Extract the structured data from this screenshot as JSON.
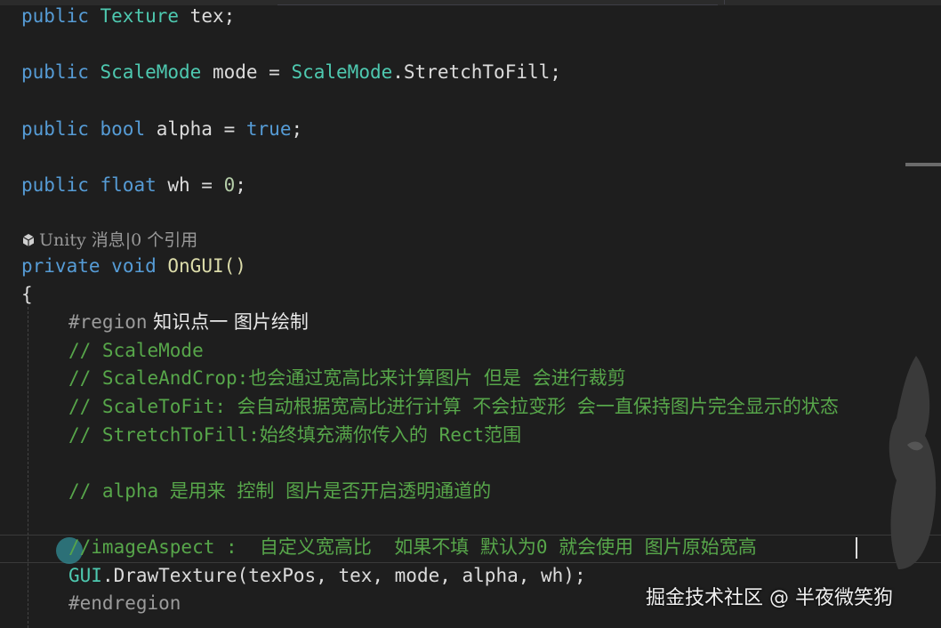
{
  "code": {
    "l1": {
      "kw": "public",
      "type": "Texture",
      "rest": " tex;"
    },
    "l2": {
      "kw": "public",
      "type": "ScaleMode",
      "mid": " mode = ",
      "type2": "ScaleMode",
      ".rest": ".StretchToFill;",
      "rest": ".StretchToFill;"
    },
    "l3": {
      "kw": "public",
      "kw2": "bool",
      "mid": " alpha = ",
      "val": "true",
      "end": ";"
    },
    "l4": {
      "kw": "public",
      "kw2": "float",
      "mid": " wh = ",
      "num": "0",
      "end": ";"
    },
    "codelens": "Unity 消息|0 个引用",
    "l5": {
      "kw": "private",
      "kw2": "void",
      "rest": " OnGUI()"
    },
    "brace": "{",
    "region_kw": "#region",
    "region_text": " 知识点一 图片绘制",
    "c1": "// ScaleMode",
    "c2": "// ScaleAndCrop:也会通过宽高比来计算图片 但是 会进行裁剪",
    "c3": "// ScaleToFit: 会自动根据宽高比进行计算 不会拉变形 会一直保持图片完全显示的状态",
    "c4": "// StretchToFill:始终填充满你传入的 Rect范围",
    "c5": "// alpha 是用来 控制 图片是否开启透明通道的",
    "c6": "//imageAspect :  自定义宽高比  如果不填 默认为0 就会使用 图片原始宽高",
    "l6": {
      "type": "GUI",
      "rest": ".DrawTexture(texPos, tex, mode, alpha, wh);"
    },
    "endregion": "#endregion"
  },
  "watermark": "掘金技术社区 @ 半夜微笑狗",
  "colors": {
    "background": "#1e1e1e",
    "keyword": "#569cd6",
    "type": "#4ec9b0",
    "comment": "#57a64a",
    "number": "#b5cea8"
  },
  "icons": {
    "codelens": "unity-icon",
    "lightbulb": "lightbulb-icon"
  }
}
